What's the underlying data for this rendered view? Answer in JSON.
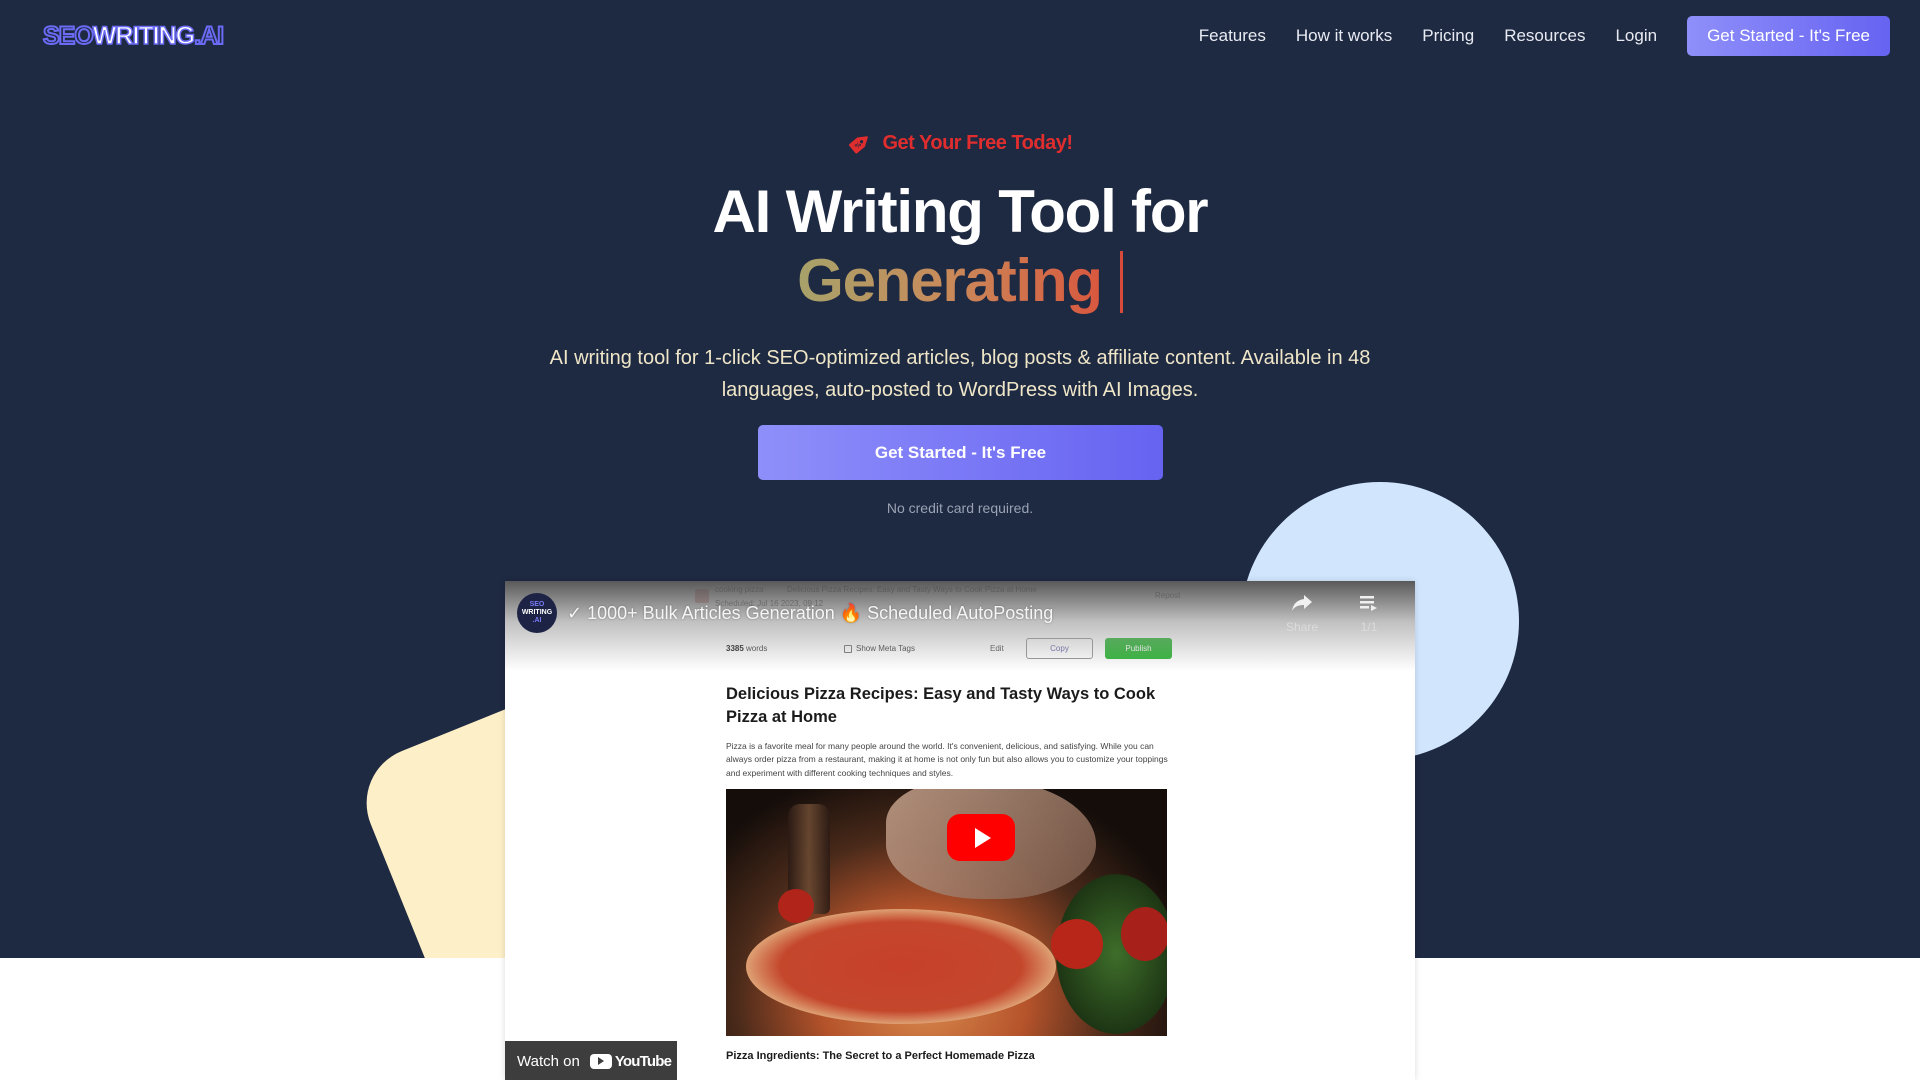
{
  "nav": {
    "logo": {
      "part1": "SEO",
      "part2": "WRITING",
      "part3": ".AI"
    },
    "links": [
      "Features",
      "How it works",
      "Pricing",
      "Resources",
      "Login"
    ],
    "cta_label": "Get Started - It's Free"
  },
  "hero": {
    "promo_icon": "price-tag-icon",
    "promo_text": "Get Your Free Today!",
    "headline_line1": "AI Writing Tool for",
    "headline_line2": "Generating",
    "subtitle": "AI writing tool for 1-click SEO-optimized articles, blog posts & affiliate content. Available in 48 languages, auto-posted to WordPress with AI Images.",
    "cta_label": "Get Started - It's Free",
    "note": "No credit card required."
  },
  "video": {
    "channel_avatar": {
      "line1": "SEO",
      "line2": "WRITING",
      "line3": ".AI"
    },
    "title": "✓ 1000+ Bulk Articles Generation 🔥 Scheduled AutoPosting",
    "share_label": "Share",
    "playlist_label": "1/1",
    "watch_on_label": "Watch on",
    "youtube_label": "YouTube",
    "content": {
      "keyword": "cooking pizza",
      "small_title": "Delicious Pizza Recipes: Easy and Tasty Ways to Cook Pizza at Home",
      "scheduled": "Scheduled: Jul 16 2023, 09:12",
      "repost": "Repost",
      "word_count": "3385",
      "word_count_suffix": "words",
      "show_meta_tags": "Show Meta Tags",
      "edit_label": "Edit",
      "copy_label": "Copy",
      "publish_label": "Publish",
      "article_title": "Delicious Pizza Recipes: Easy and Tasty Ways to Cook Pizza at Home",
      "article_body": "Pizza is a favorite meal for many people around the world. It's convenient, delicious, and satisfying. While you can always order pizza from a restaurant, making it at home is not only fun but also allows you to customize your toppings and experiment with different cooking techniques and styles.",
      "section_heading": "Pizza Ingredients: The Secret to a Perfect Homemade Pizza"
    }
  },
  "colors": {
    "background": "#1e2942",
    "accent": "#6b6bf5",
    "promo": "#e02d2d",
    "circle": "#d1e6fd",
    "square": "#fdf0c8",
    "publish": "#2fb637",
    "youtube_red": "#ff0000"
  }
}
